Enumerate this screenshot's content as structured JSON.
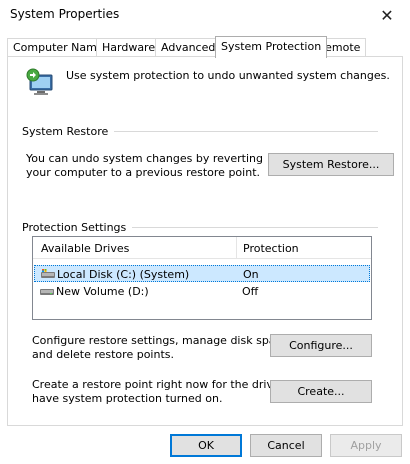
{
  "window": {
    "title": "System Properties"
  },
  "tabs": [
    {
      "label": "Computer Name"
    },
    {
      "label": "Hardware"
    },
    {
      "label": "Advanced"
    },
    {
      "label": "System Protection"
    },
    {
      "label": "Remote"
    }
  ],
  "intro": {
    "text": "Use system protection to undo unwanted system changes."
  },
  "system_restore": {
    "heading": "System Restore",
    "line1": "You can undo system changes by reverting",
    "line2": "your computer to a previous restore point.",
    "button": "System Restore..."
  },
  "protection": {
    "heading": "Protection Settings",
    "columns": [
      "Available Drives",
      "Protection"
    ],
    "drives": [
      {
        "name": "Local Disk (C:) (System)",
        "protection": "On"
      },
      {
        "name": "New Volume (D:)",
        "protection": "Off"
      }
    ]
  },
  "configure": {
    "line1": "Configure restore settings, manage disk space,",
    "line2": "and delete restore points.",
    "button": "Configure..."
  },
  "create": {
    "line1": "Create a restore point right now for the drives that",
    "line2": "have system protection turned on.",
    "button": "Create..."
  },
  "footer": {
    "ok": "OK",
    "cancel": "Cancel",
    "apply": "Apply"
  },
  "colors": {
    "accent": "#0078d7",
    "selection": "#cce8ff"
  }
}
